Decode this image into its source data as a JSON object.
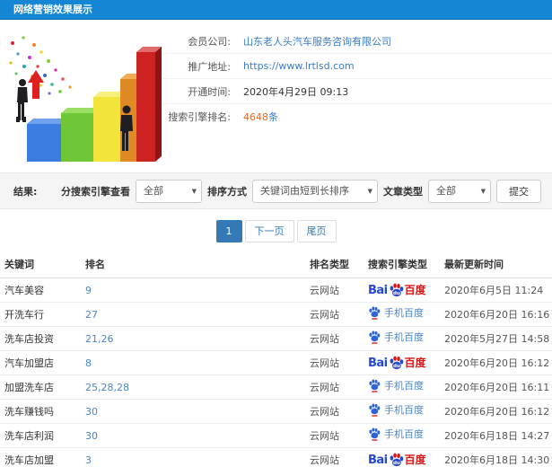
{
  "colors": {
    "header_bg": "#1486d3",
    "link_blue": "#3a7bc8",
    "highlight_orange": "#ff6600",
    "pagination_active": "#337ab7",
    "baidu_blue": "#2848d0",
    "baidu_red": "#de1414"
  },
  "header": {
    "title": "网络营销效果展示"
  },
  "info": {
    "rows": [
      {
        "label": "会员公司:",
        "value": "山东老人头汽车服务咨询有限公司"
      },
      {
        "label": "推广地址:",
        "value": "https://www.lrtlsd.com"
      },
      {
        "label": "开通时间:",
        "value": "2020年4月29日 09:13"
      },
      {
        "label": "搜索引擎排名:",
        "value": "4648",
        "suffix": "条"
      }
    ]
  },
  "filter": {
    "result_label": "结果:",
    "engine_label": "分搜索引擎查看",
    "engine_value": "全部",
    "sort_label": "排序方式",
    "sort_value": "关键词由短到长排序",
    "article_label": "文章类型",
    "article_value": "全部",
    "submit_label": "提交"
  },
  "pagination": {
    "current": "1",
    "next": "下一页",
    "last": "尾页"
  },
  "logos": {
    "bai": "Bai",
    "du": "du",
    "cn": "百度",
    "mobile_text": "手机百度"
  },
  "table": {
    "headers": [
      "关键词",
      "排名",
      "排名类型",
      "搜索引擎类型",
      "最新更新时间"
    ],
    "rows": [
      {
        "keyword": "汽车美容",
        "rank": "9",
        "rank_type": "云网站",
        "engine": "baidu-pc",
        "time": "2020年6月5日 11:24"
      },
      {
        "keyword": "开洗车行",
        "rank": "27",
        "rank_type": "云网站",
        "engine": "baidu-mobile",
        "time": "2020年6月20日 16:16"
      },
      {
        "keyword": "洗车店投资",
        "rank": "21,26",
        "rank_type": "云网站",
        "engine": "baidu-mobile",
        "time": "2020年5月27日 14:58"
      },
      {
        "keyword": "汽车加盟店",
        "rank": "8",
        "rank_type": "云网站",
        "engine": "baidu-pc",
        "time": "2020年6月20日 16:12"
      },
      {
        "keyword": "加盟洗车店",
        "rank": "25,28,28",
        "rank_type": "云网站",
        "engine": "baidu-mobile",
        "time": "2020年6月20日 16:11"
      },
      {
        "keyword": "洗车赚钱吗",
        "rank": "30",
        "rank_type": "云网站",
        "engine": "baidu-mobile",
        "time": "2020年6月20日 16:12"
      },
      {
        "keyword": "洗车店利润",
        "rank": "30",
        "rank_type": "云网站",
        "engine": "baidu-mobile",
        "time": "2020年6月18日 14:27"
      },
      {
        "keyword": "洗车店加盟",
        "rank": "3",
        "rank_type": "云网站",
        "engine": "baidu-pc",
        "time": "2020年6月18日 14:30"
      }
    ]
  }
}
